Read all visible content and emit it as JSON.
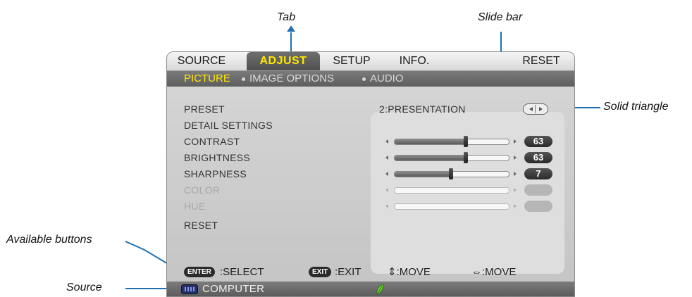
{
  "callouts": {
    "tab": "Tab",
    "slide_bar": "Slide bar",
    "solid_triangle": "Solid triangle",
    "available_buttons": "Available buttons",
    "source": "Source"
  },
  "tabs": [
    {
      "label": "SOURCE",
      "active": false
    },
    {
      "label": "ADJUST",
      "active": true
    },
    {
      "label": "SETUP",
      "active": false
    },
    {
      "label": "INFO.",
      "active": false
    },
    {
      "label": "RESET",
      "active": false
    }
  ],
  "subtabs": [
    {
      "label": "PICTURE",
      "active": true
    },
    {
      "label": "IMAGE OPTIONS",
      "active": false
    },
    {
      "label": "AUDIO",
      "active": false
    }
  ],
  "settings": [
    {
      "label": "PRESET",
      "enabled": true,
      "value": "2:PRESENTATION"
    },
    {
      "label": "DETAIL SETTINGS",
      "enabled": true
    },
    {
      "label": "CONTRAST",
      "enabled": true,
      "value": "63",
      "level": 0.63
    },
    {
      "label": "BRIGHTNESS",
      "enabled": true,
      "value": "63",
      "level": 0.63
    },
    {
      "label": "SHARPNESS",
      "enabled": true,
      "value": "7",
      "level": 0.5
    },
    {
      "label": "COLOR",
      "enabled": false
    },
    {
      "label": "HUE",
      "enabled": false
    },
    {
      "label": "RESET",
      "enabled": true
    }
  ],
  "buttons": {
    "enter_badge": "ENTER",
    "enter_text": ":SELECT",
    "exit_badge": "EXIT",
    "exit_text": ":EXIT",
    "move_v_text": "⇕:MOVE",
    "move_h_text": "⇔:MOVE"
  },
  "source": {
    "label": "COMPUTER",
    "icon": "monitor-icon",
    "eco_icon": "leaf-icon"
  },
  "colors": {
    "active_tab_text": "#ffe800",
    "callout_line": "#1f6fb2"
  }
}
